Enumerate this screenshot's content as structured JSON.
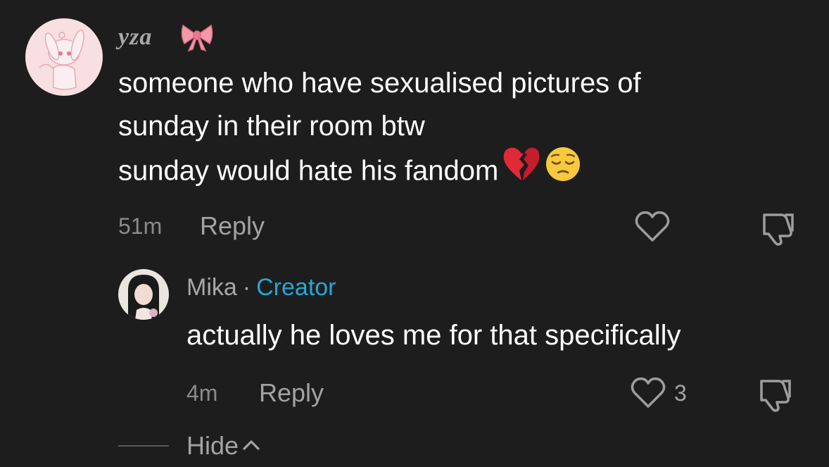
{
  "comment": {
    "username": "yza",
    "username_emoji": "ribbon-emoji",
    "text_lines": [
      "someone who have sexualised pictures of",
      "sunday in their room btw",
      "sunday would hate his fandom"
    ],
    "text_emojis": [
      "broken-heart-emoji",
      "pensive-face-emoji"
    ],
    "timestamp": "51m",
    "reply_label": "Reply"
  },
  "reply": {
    "username": "Mika",
    "separator": "·",
    "badge": "Creator",
    "text": "actually he loves me for that specifically",
    "timestamp": "4m",
    "reply_label": "Reply",
    "like_count": "3"
  },
  "thread": {
    "hide_label": "Hide"
  },
  "colors": {
    "background": "#1d1d1d",
    "text": "#ffffff",
    "muted": "#a3a3a3",
    "creator_badge": "#25a7d6"
  }
}
